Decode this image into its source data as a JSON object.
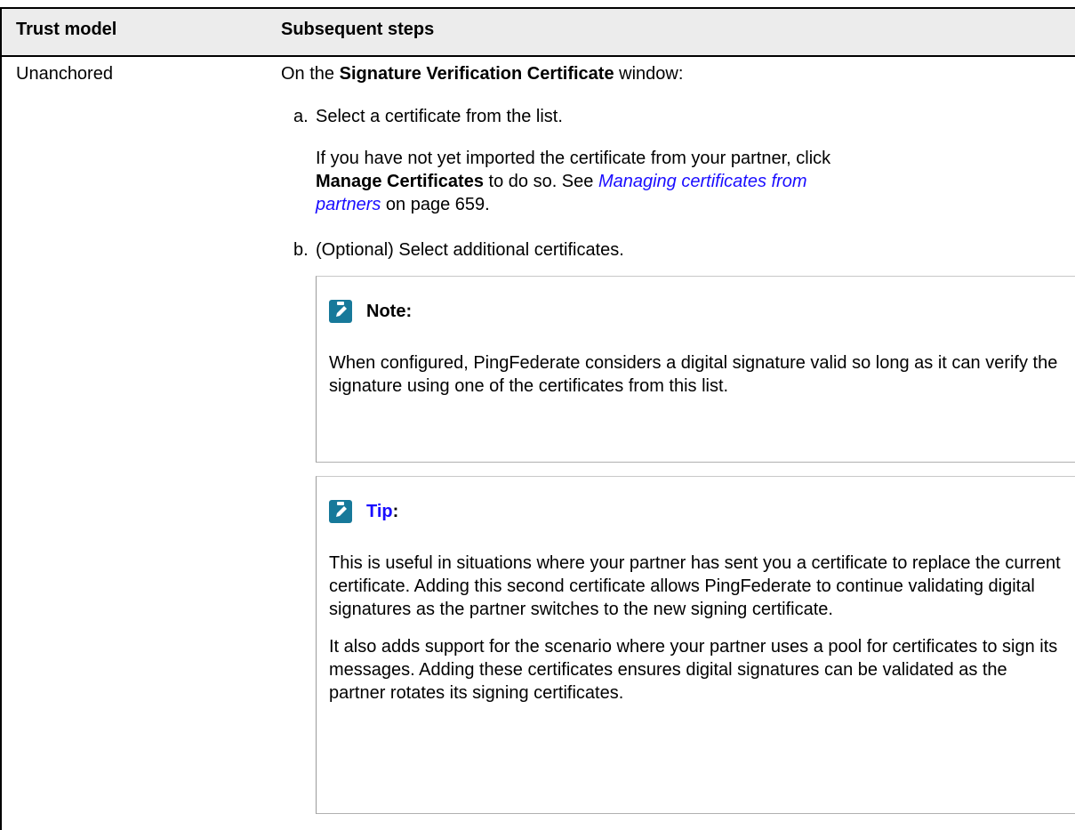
{
  "table": {
    "headers": [
      "Trust model",
      "Subsequent steps"
    ],
    "row": {
      "trust_model": "Unanchored",
      "intro_prefix": "On the ",
      "intro_bold": "Signature Verification Certificate",
      "intro_suffix": " window:",
      "steps": [
        {
          "marker": "a.",
          "text": "Select a certificate from the list.",
          "detail": {
            "line1": "If you have not yet imported the certificate from your partner, click",
            "bold": "Manage Certificates",
            "mid": " to do so. See ",
            "link_part1": "Managing certificates from",
            "link_part2": "partners",
            "suffix": " on page 659."
          }
        },
        {
          "marker": "b.",
          "text": "(Optional) Select additional certificates."
        }
      ],
      "note": {
        "icon": "pencil-note-icon",
        "title": "Note:",
        "body": "When configured, PingFederate considers a digital signature valid so long as it can verify the signature using one of the certificates from this list."
      },
      "tip": {
        "icon": "pencil-note-icon",
        "title_link": "Tip",
        "title_suffix": ":",
        "paragraphs": [
          "This is useful in situations where your partner has sent you a certificate to replace the current certificate. Adding this second certificate allows PingFederate to continue validating digital signatures as the partner switches to the new signing certificate.",
          "It also adds support for the scenario where your partner uses a pool for certificates to sign its messages. Adding these certificates ensures digital signatures can be validated as the partner rotates its signing certificates."
        ]
      }
    }
  },
  "colors": {
    "header_bg": "#ececec",
    "link": "#1a0dff",
    "icon_bg": "#17799a"
  }
}
